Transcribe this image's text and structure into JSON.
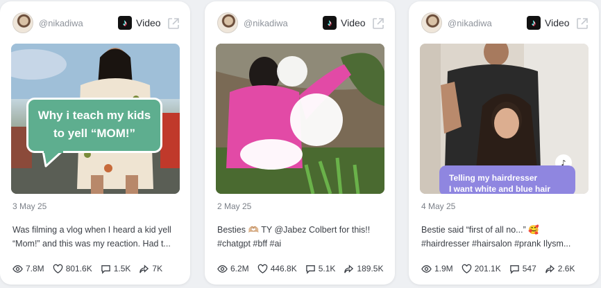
{
  "cards": [
    {
      "handle": "@nikadiwa",
      "type_label": "Video",
      "date": "3 May 25",
      "caption_lines": [
        "Was filming a vlog when I heard a kid yell",
        "“Mom!” and this was my reaction. Had t..."
      ],
      "overlay_lines": [
        "Why i teach my kids",
        "to yell “MOM!”"
      ],
      "stats": {
        "views": "7.8M",
        "likes": "801.6K",
        "comments": "1.5K",
        "shares": "7K"
      }
    },
    {
      "handle": "@nikadiwa",
      "type_label": "Video",
      "date": "2 May 25",
      "caption_lines": [
        "Besties 🫶🏼 TY @Jabez Colbert for this!!",
        "#chatgpt #bff #ai"
      ],
      "stats": {
        "views": "6.2M",
        "likes": "446.8K",
        "comments": "5.1K",
        "shares": "189.5K"
      }
    },
    {
      "handle": "@nikadiwa",
      "type_label": "Video",
      "date": "4 May 25",
      "caption_lines": [
        "Bestie said “first of all no...” 🥰",
        "#hairdresser #hairsalon #prank Ilysm..."
      ],
      "overlay_lines": [
        "Telling my hairdresser",
        "I want white and blue hair"
      ],
      "stats": {
        "views": "1.9M",
        "likes": "201.1K",
        "comments": "547",
        "shares": "2.6K"
      }
    }
  ],
  "colors": {
    "speech_bubble": "#5eae8f",
    "overlay_purple": "#8f86e0",
    "hoodie_pink": "#e24aa6"
  }
}
